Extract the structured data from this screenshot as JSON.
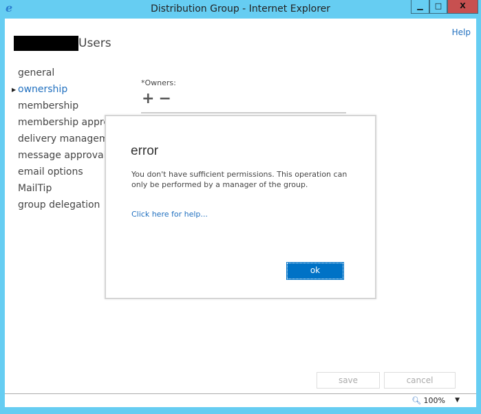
{
  "window": {
    "title": "Distribution Group - Internet Explorer",
    "minimize": "▁",
    "maximize": "□",
    "close": "X",
    "colors": {
      "frame": "#66cdf2",
      "close": "#c75050",
      "accent": "#0072c6"
    }
  },
  "page": {
    "help": "Help",
    "heading": "Users"
  },
  "nav": [
    {
      "label": "general"
    },
    {
      "label": "ownership",
      "selected": true
    },
    {
      "label": "membership"
    },
    {
      "label": "membership approval"
    },
    {
      "label": "delivery management"
    },
    {
      "label": "message approval"
    },
    {
      "label": "email options"
    },
    {
      "label": "MailTip"
    },
    {
      "label": "group delegation"
    }
  ],
  "owners": {
    "label": "*Owners:",
    "add": "+",
    "remove": "−"
  },
  "dialog": {
    "title": "error",
    "message": "You don't have sufficient permissions. This operation can only be performed by a manager of the group.",
    "help_link": "Click here for help...",
    "ok": "ok"
  },
  "footer": {
    "save": "save",
    "cancel": "cancel"
  },
  "statusbar": {
    "zoom": "100%"
  }
}
